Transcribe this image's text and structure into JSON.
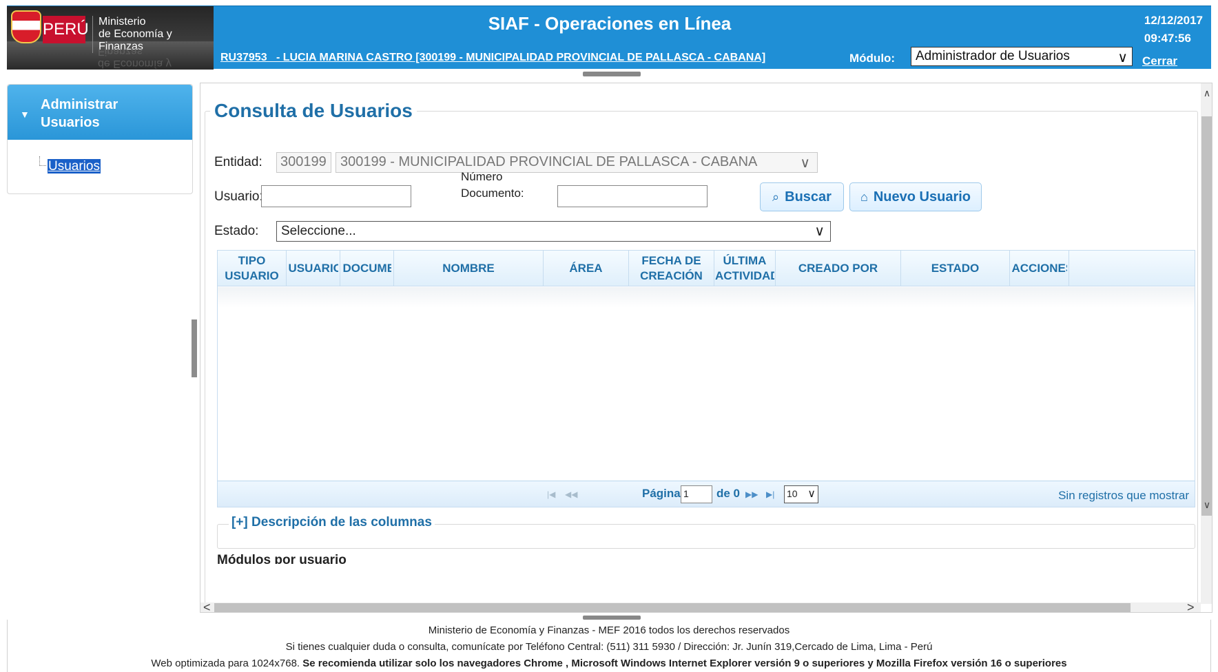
{
  "header": {
    "country": "PERÚ",
    "ministry_line1": "Ministerio",
    "ministry_line2": "de Economía y Finanzas",
    "app_title": "SIAF - Operaciones en Línea",
    "date": "12/12/2017",
    "time": "09:47:56",
    "user_info": "RU37953   - LUCIA MARINA CASTRO [300199 - MUNICIPALIDAD PROVINCIAL DE PALLASCA - CABANA]",
    "module_label": "Módulo:",
    "module_value": "Administrador de Usuarios",
    "logout_label": "Cerrar sesión",
    "colors": {
      "header_blue": "#1f8fd6",
      "accent": "#1f6fa7"
    }
  },
  "sidebar": {
    "section_title_1": "Administrar",
    "section_title_2": "Usuarios",
    "items": [
      {
        "label": "Usuarios",
        "selected": true
      }
    ]
  },
  "main": {
    "title": "Consulta de Usuarios",
    "entidad_label": "Entidad:",
    "entidad_code": "300199",
    "entidad_value": "300199 - MUNICIPALIDAD PROVINCIAL DE PALLASCA - CABANA",
    "usuario_label": "Usuario:",
    "usuario_value": "",
    "numdoc_label_1": "Número",
    "numdoc_label_2": "Documento:",
    "numdoc_value": "",
    "search_label": "Buscar",
    "new_user_label": "Nuevo Usuario",
    "estado_label": "Estado:",
    "estado_value": "Seleccione...",
    "grid": {
      "columns": [
        {
          "line1": "TIPO",
          "line2": "USUARIO"
        },
        {
          "line1": "USUARIO",
          "line2": ""
        },
        {
          "line1": "DOCUMENTO",
          "line2": ""
        },
        {
          "line1": "NOMBRE",
          "line2": ""
        },
        {
          "line1": "ÁREA",
          "line2": ""
        },
        {
          "line1": "FECHA DE",
          "line2": "CREACIÓN"
        },
        {
          "line1": "ÚLTIMA",
          "line2": "ACTIVIDAD"
        },
        {
          "line1": "CREADO POR",
          "line2": ""
        },
        {
          "line1": "ESTADO",
          "line2": ""
        },
        {
          "line1": "ACCIONES",
          "line2": ""
        }
      ],
      "rows": []
    },
    "pager": {
      "page_label": "Página",
      "page_value": "1",
      "of_label": "de 0",
      "page_size": "10",
      "status": "Sin registros que mostrar"
    },
    "desc_columns_label": "[+] Descripción de las columnas",
    "modulos_title": "Módulos por usuario"
  },
  "footer": {
    "line1": "Ministerio de Economía y Finanzas - MEF 2016 todos los derechos reservados",
    "line2": "Si tienes cualquier duda o consulta, comunícate por Teléfono Central: (511) 311 5930 / Dirección: Jr. Junín 319,Cercado de Lima, Lima - Perú",
    "line3_prefix": "Web optimizada para 1024x768. ",
    "line3_bold": "Se recomienda utilizar solo los navegadores Chrome , Microsoft Windows Internet Explorer versión 9 o superiores y Mozilla Firefox versión 16 o superiores"
  }
}
